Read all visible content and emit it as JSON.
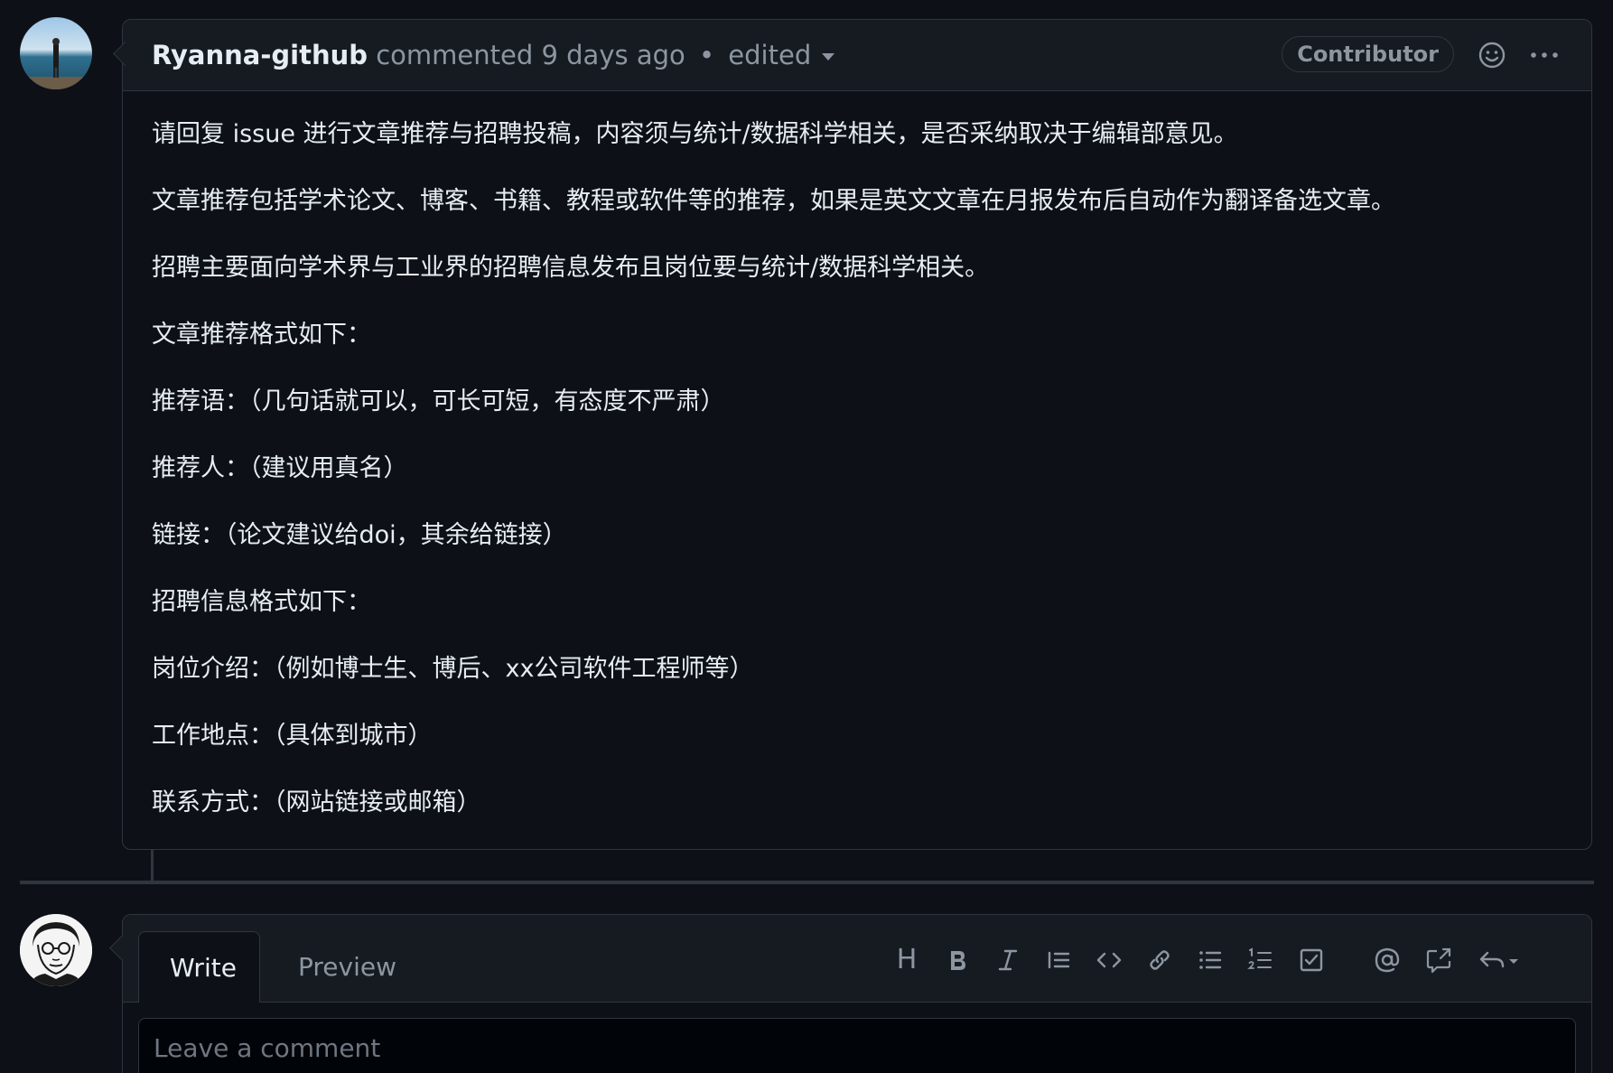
{
  "comment": {
    "author": "Ryanna-github",
    "action": "commented",
    "time": "9 days ago",
    "separator": "•",
    "edited_label": "edited",
    "role_badge": "Contributor",
    "reaction_icon": "smiley-icon",
    "menu_icon": "kebab-horizontal-icon",
    "body": [
      "请回复 issue 进行文章推荐与招聘投稿，内容须与统计/数据科学相关，是否采纳取决于编辑部意见。",
      "文章推荐包括学术论文、博客、书籍、教程或软件等的推荐，如果是英文文章在月报发布后自动作为翻译备选文章。",
      "招聘主要面向学术界与工业界的招聘信息发布且岗位要与统计/数据科学相关。",
      "文章推荐格式如下：",
      "推荐语：（几句话就可以，可长可短，有态度不严肃）",
      "推荐人：（建议用真名）",
      "链接：（论文建议给doi，其余给链接）",
      "招聘信息格式如下：",
      "岗位介绍：（例如博士生、博后、xx公司软件工程师等）",
      "工作地点：（具体到城市）",
      "联系方式：（网站链接或邮箱）"
    ]
  },
  "editor": {
    "tabs": {
      "write": "Write",
      "preview": "Preview"
    },
    "toolbar": {
      "heading_label": "H",
      "icons": [
        "heading-icon",
        "bold-icon",
        "italic-icon",
        "quote-icon",
        "code-icon",
        "link-icon",
        "bullet-list-icon",
        "numbered-list-icon",
        "task-list-icon",
        "mention-icon",
        "reference-icon",
        "reply-icon"
      ]
    },
    "placeholder": "Leave a comment"
  },
  "colors": {
    "background": "#0d1117",
    "header_bg": "#161b22",
    "border": "#30363d",
    "text": "#e6edf3",
    "muted": "#8d96a0"
  }
}
